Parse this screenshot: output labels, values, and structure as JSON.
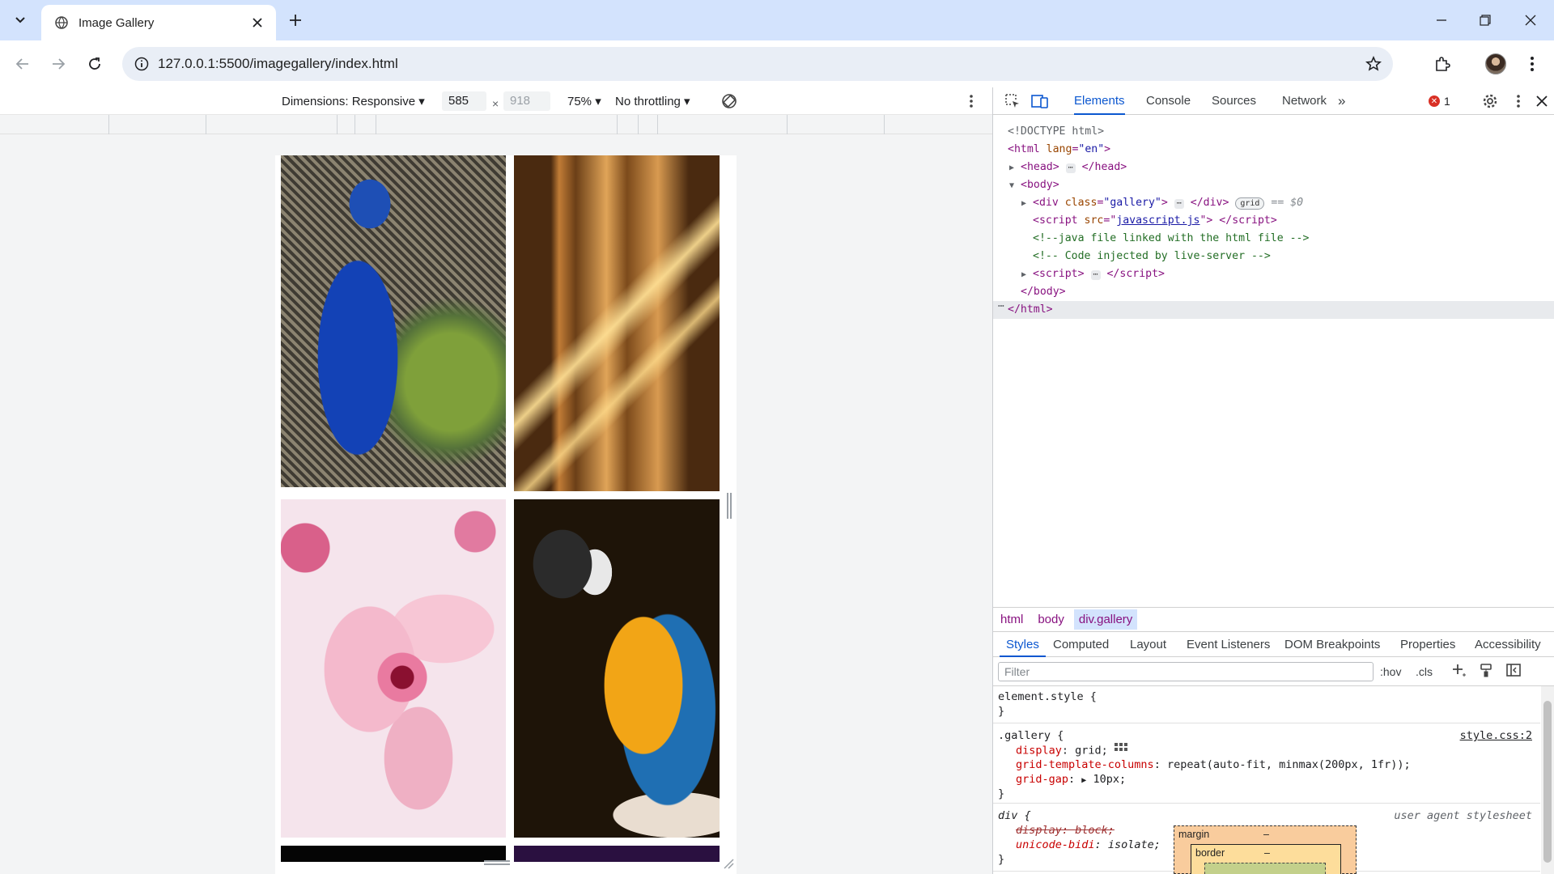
{
  "browser": {
    "tab_title": "Image Gallery",
    "url": "127.0.0.1:5500/imagegallery/index.html"
  },
  "device_toolbar": {
    "dimensions_label": "Dimensions: Responsive",
    "width": "585",
    "height": "918",
    "times": "×",
    "zoom": "75%",
    "throttling": "No throttling"
  },
  "devtools": {
    "tabs": [
      "Elements",
      "Console",
      "Sources",
      "Network"
    ],
    "more_tabs": "»",
    "error_count": "1",
    "dom": {
      "doctype": "<!DOCTYPE html>",
      "html_open_tag": "html",
      "html_lang_attr": "lang",
      "html_lang_val": "\"en\"",
      "head": "head",
      "body": "body",
      "div_tag": "div",
      "div_class_attr": "class",
      "div_class_val": "\"gallery\"",
      "grid_badge": "grid",
      "selected_marker": "== $0",
      "script_tag": "script",
      "script_src_attr": "src",
      "script_src_val": "javascript.js",
      "comment1": "<!--java file linked with the html file -->",
      "comment2": "<!-- Code injected by live-server -->"
    },
    "breadcrumbs": [
      "html",
      "body",
      "div.gallery"
    ],
    "subtabs": [
      "Styles",
      "Computed",
      "Layout",
      "Event Listeners",
      "DOM Breakpoints",
      "Properties",
      "Accessibility"
    ],
    "filter_placeholder": "Filter",
    "filter_tools": {
      "hov": ":hov",
      "cls": ".cls"
    },
    "styles": {
      "element_style": "element.style {",
      "close_brace": "}",
      "gallery_selector": ".gallery {",
      "gallery_source": "style.css:2",
      "prop_display": "display",
      "val_display": "grid;",
      "prop_gtc": "grid-template-columns",
      "val_gtc": "repeat(auto-fit, minmax(200px, 1fr));",
      "prop_gap": "grid-gap",
      "val_gap": "10px;",
      "div_selector": "div {",
      "ua_source": "user agent stylesheet",
      "prop_display_ua": "display",
      "val_display_ua": "block;",
      "prop_unicode": "unicode-bidi",
      "val_unicode": "isolate;"
    },
    "box_model": {
      "margin": "margin",
      "border": "border",
      "dash": "–"
    }
  },
  "colors": {
    "accent": "#0b57d0",
    "tabstrip": "#d3e3fd",
    "tag": "#881280",
    "attr": "#994500",
    "comment": "#236e25",
    "error": "#d93025"
  }
}
